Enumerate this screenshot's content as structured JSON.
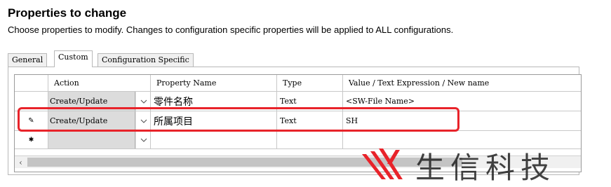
{
  "header": {
    "title": "Properties to change",
    "description": "Choose properties to modify.  Changes to configuration specific properties will be applied to ALL configurations."
  },
  "tabs": [
    {
      "label": "General",
      "active": false
    },
    {
      "label": "Custom",
      "active": true
    },
    {
      "label": "Configuration Specific",
      "active": false
    }
  ],
  "grid": {
    "columns": [
      "Action",
      "Property Name",
      "Type",
      "Value / Text Expression / New name"
    ],
    "rows": [
      {
        "indicator": "",
        "action": "Create/Update",
        "name": "零件名称",
        "type": "Text",
        "value": "<SW-File Name>"
      },
      {
        "indicator": "✎",
        "action": "Create/Update",
        "name": "所属项目",
        "type": "Text",
        "value": "SH"
      },
      {
        "indicator": "✱",
        "action": "",
        "name": "",
        "type": "",
        "value": ""
      }
    ]
  },
  "watermark": {
    "text": "生信科技"
  },
  "colors": {
    "highlight": "#e8232a",
    "combo_bg": "#dcdcdc"
  }
}
